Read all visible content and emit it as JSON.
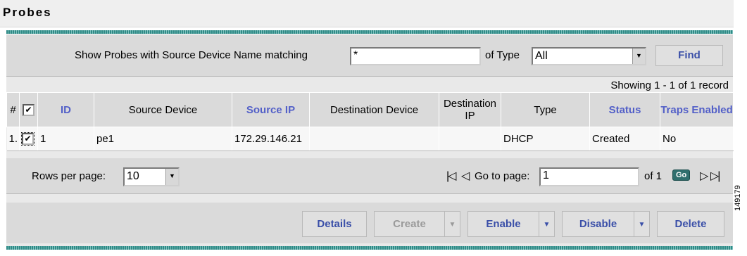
{
  "page": {
    "title": "Probes"
  },
  "filter": {
    "label": "Show Probes with Source Device Name matching",
    "name_value": "*",
    "type_label": "of Type",
    "type_value": "All",
    "find_label": "Find"
  },
  "table": {
    "showing": "Showing 1 - 1 of 1 record",
    "columns": [
      "#",
      "",
      "ID",
      "Source Device",
      "Source IP",
      "Destination Device",
      "Destination IP",
      "Type",
      "Status",
      "Traps Enabled"
    ],
    "rows": [
      {
        "num": "1.",
        "id": "1",
        "source_device": "pe1",
        "source_ip": "172.29.146.21",
        "destination_device": "",
        "destination_ip": "",
        "type": "DHCP",
        "status": "Created",
        "traps": "No"
      }
    ]
  },
  "pager": {
    "rows_label": "Rows per page:",
    "rows_value": "10",
    "goto_label": "Go to page:",
    "page_value": "1",
    "of_label": "of 1",
    "go_label": "Go"
  },
  "actions": {
    "details": "Details",
    "create": "Create",
    "enable": "Enable",
    "disable": "Disable",
    "delete": "Delete"
  },
  "side_code": "149179",
  "colors": {
    "accent": "#3a4fa8",
    "header_link": "#5360c8",
    "teal": "#2f8a86"
  }
}
